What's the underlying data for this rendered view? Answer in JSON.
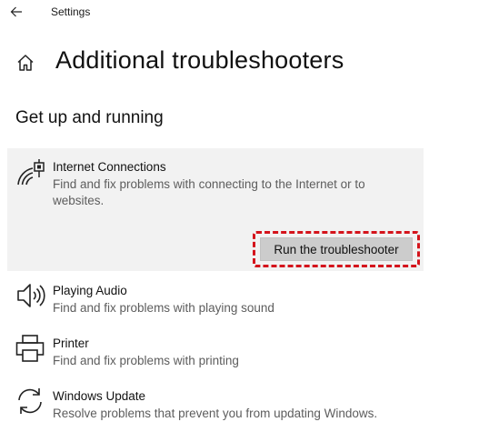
{
  "window": {
    "app_title": "Settings",
    "back_icon": "back-arrow-icon"
  },
  "header": {
    "home_icon": "home-icon",
    "page_title": "Additional troubleshooters"
  },
  "section": {
    "heading": "Get up and running"
  },
  "troubleshooters": [
    {
      "icon": "wifi-network-icon",
      "name": "Internet Connections",
      "description": "Find and fix problems with connecting to the Internet or to websites.",
      "expanded": true,
      "action_label": "Run the troubleshooter"
    },
    {
      "icon": "speaker-icon",
      "name": "Playing Audio",
      "description": "Find and fix problems with playing sound"
    },
    {
      "icon": "printer-icon",
      "name": "Printer",
      "description": "Find and fix problems with printing"
    },
    {
      "icon": "refresh-icon",
      "name": "Windows Update",
      "description": "Resolve problems that prevent you from updating Windows."
    }
  ],
  "colors": {
    "expanded_background": "#f2f2f2",
    "button_background": "#cccccc",
    "highlight_border": "#d4141c",
    "description_text": "#5d5d5d"
  }
}
